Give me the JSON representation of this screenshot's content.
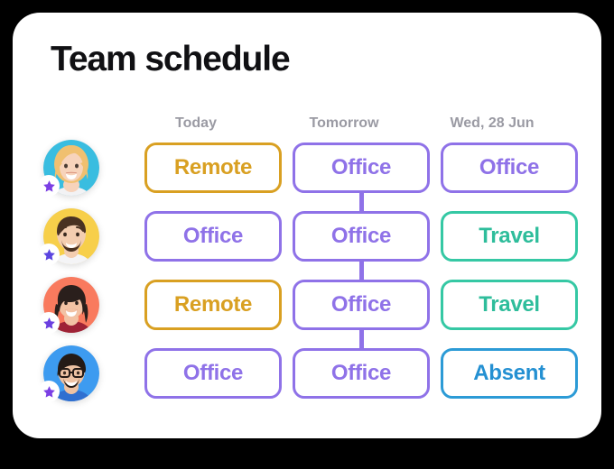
{
  "card": {
    "title": "Team schedule",
    "background_color": "#ffffff",
    "page_background_color": "#000000"
  },
  "columns": [
    {
      "label": "Today"
    },
    {
      "label": "Tomorrow"
    },
    {
      "label": "Wed, 28 Jun"
    }
  ],
  "status_colors": {
    "office": "#8f72e8",
    "remote": "#d9a022",
    "travel": "#2ebd9b",
    "absent": "#2490d2",
    "badge_star": "#7b3fe4",
    "header_text": "#9a9aa3",
    "title_text": "#101013"
  },
  "rows": [
    {
      "avatar": {
        "name": "avatar-person-1",
        "background_color": "#39bde0",
        "hair_color": "#f0c070",
        "skin_color": "#f7d3bb",
        "shirt_color": "#f2f2f4",
        "badge_icon": "star-icon"
      },
      "cells": [
        {
          "label": "Remote",
          "status": "remote"
        },
        {
          "label": "Office",
          "status": "office"
        },
        {
          "label": "Office",
          "status": "office"
        }
      ]
    },
    {
      "avatar": {
        "name": "avatar-person-2",
        "background_color": "#f7cf4a",
        "hair_color": "#4a3222",
        "skin_color": "#f3cdb0",
        "shirt_color": "#f4f4f6",
        "badge_icon": "star-icon"
      },
      "cells": [
        {
          "label": "Office",
          "status": "office"
        },
        {
          "label": "Office",
          "status": "office"
        },
        {
          "label": "Travel",
          "status": "travel"
        }
      ]
    },
    {
      "avatar": {
        "name": "avatar-person-3",
        "background_color": "#f97a5e",
        "hair_color": "#2a1f1c",
        "skin_color": "#f2c2a4",
        "shirt_color": "#9e2236",
        "badge_icon": "star-icon"
      },
      "cells": [
        {
          "label": "Remote",
          "status": "remote"
        },
        {
          "label": "Office",
          "status": "office"
        },
        {
          "label": "Travel",
          "status": "travel"
        }
      ]
    },
    {
      "avatar": {
        "name": "avatar-person-4",
        "background_color": "#3d9bf0",
        "hair_color": "#241a16",
        "skin_color": "#eec2a3",
        "shirt_color": "#2f6fd0",
        "badge_icon": "star-icon"
      },
      "cells": [
        {
          "label": "Office",
          "status": "office"
        },
        {
          "label": "Office",
          "status": "office"
        },
        {
          "label": "Absent",
          "status": "absent"
        }
      ]
    }
  ]
}
